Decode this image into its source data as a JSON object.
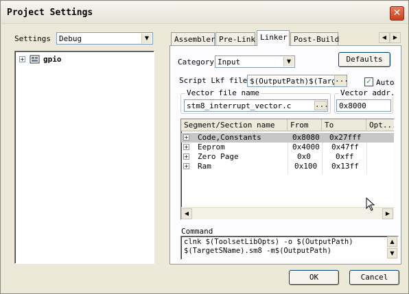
{
  "window": {
    "title": "Project Settings",
    "close_symbol": "✕"
  },
  "settings": {
    "label": "Settings",
    "selected": "Debug",
    "tree": {
      "expander": "+",
      "node_label": "gpio"
    }
  },
  "tabs": [
    {
      "label": "Assembler",
      "active": false
    },
    {
      "label": "Pre-Link",
      "active": false
    },
    {
      "label": "Linker",
      "active": true
    },
    {
      "label": "Post-Build",
      "active": false
    }
  ],
  "tab_scroll": {
    "left": "◀",
    "right": "▶"
  },
  "linker": {
    "category_label": "Category",
    "category_value": "Input",
    "defaults_button": "Defaults",
    "script_label": "Script Lkf file",
    "script_value": "$(OutputPath)$(TargetSN",
    "browse_label": "...",
    "auto_label": "Auto",
    "auto_checked": true,
    "auto_check_mark": "✓",
    "vector_file_group": "Vector file name",
    "vector_file_value": "stm8_interrupt_vector.c",
    "vector_addr_group": "Vector addr.",
    "vector_addr_value": "0x8000",
    "segments": {
      "columns": [
        "Segment/Section name",
        "From",
        "To",
        "Opt..."
      ],
      "rows": [
        {
          "expander": "+",
          "name": "Code,Constants",
          "from": "0x8080",
          "to": "0x27fff",
          "opt": "",
          "selected": true
        },
        {
          "expander": "+",
          "name": "Eeprom",
          "from": "0x4000",
          "to": "0x47ff",
          "opt": "",
          "selected": false
        },
        {
          "expander": "+",
          "name": "Zero Page",
          "from": "0x0",
          "to": "0xff",
          "opt": "",
          "selected": false
        },
        {
          "expander": "+",
          "name": "Ram",
          "from": "0x100",
          "to": "0x13ff",
          "opt": "",
          "selected": false
        }
      ]
    },
    "command_label": "Command",
    "command_line1": "clnk $(ToolsetLibOpts) -o $(OutputPath)",
    "command_line2": "$(TargetSName).sm8 -m$(OutputPath)"
  },
  "footer": {
    "ok": "OK",
    "cancel": "Cancel"
  },
  "icons": {
    "dropdown_arrow": "▼",
    "scroll_left": "◀",
    "scroll_right": "▶",
    "scroll_up": "▲",
    "scroll_down": "▼"
  },
  "colors": {
    "selection": "#c6c6c6",
    "close_button": "#c8401e",
    "panel": "#fcfcfe",
    "dialog": "#ece9d8"
  }
}
